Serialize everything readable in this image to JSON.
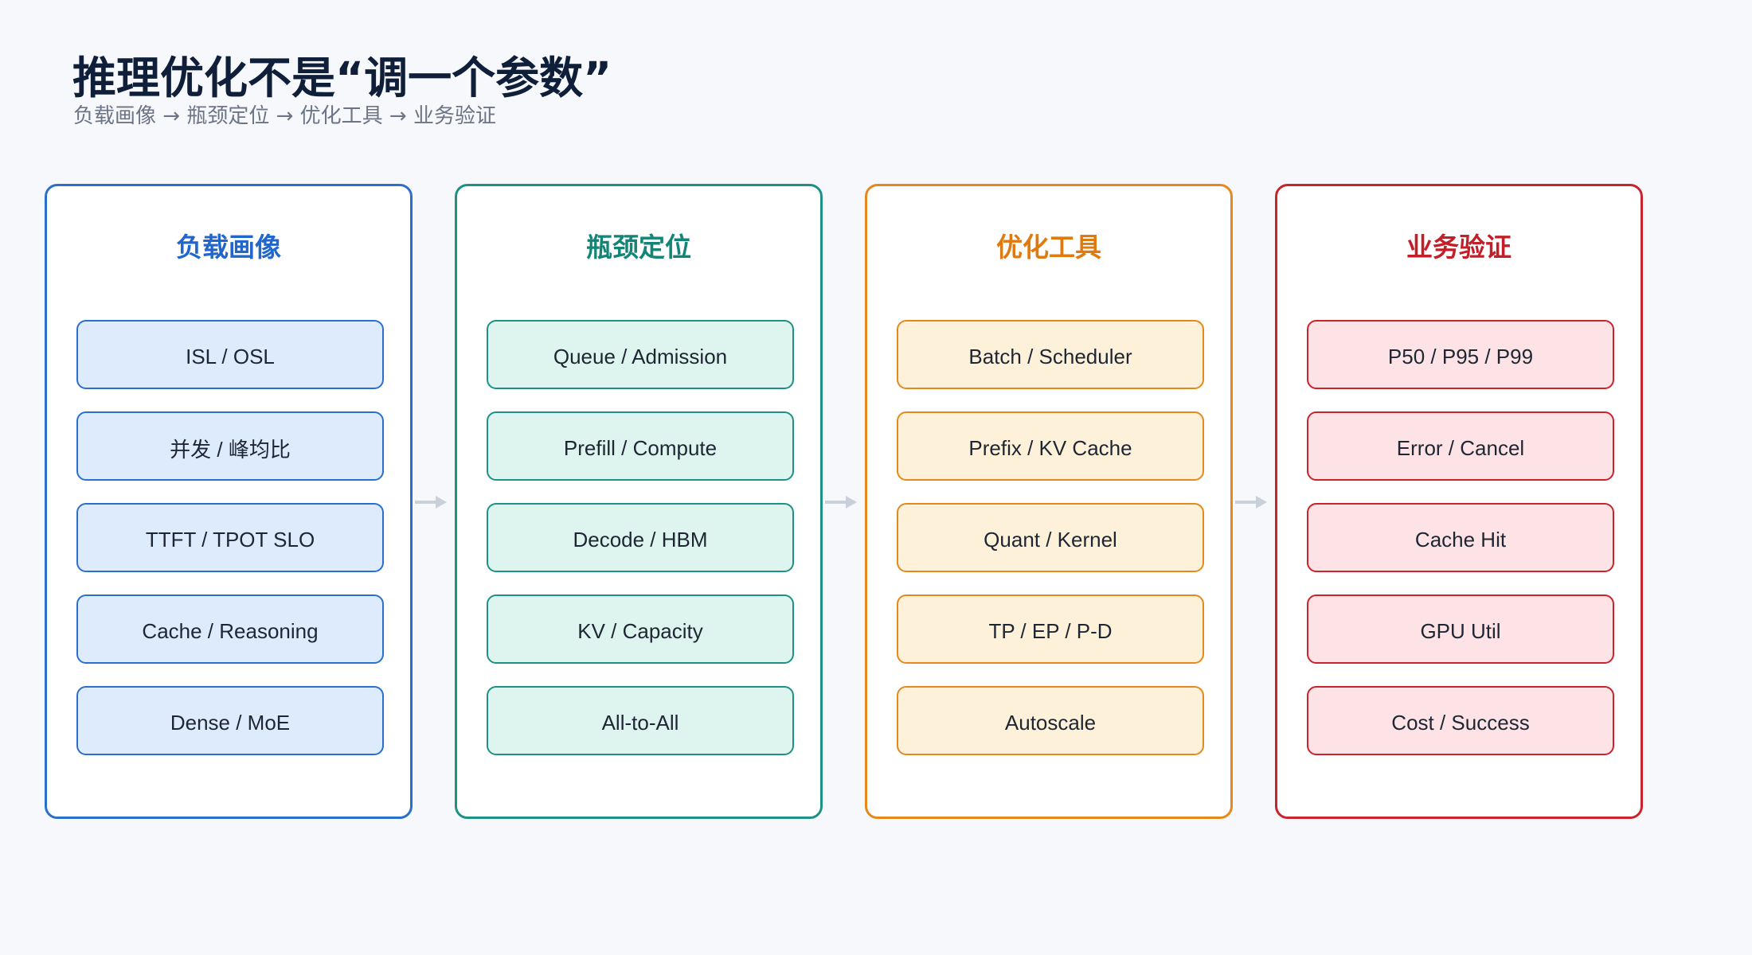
{
  "title": "推理优化不是“调一个参数”",
  "subtitle": "负载画像 → 瓶颈定位 → 优化工具 → 业务验证",
  "columns": [
    {
      "title": "负载画像",
      "items": [
        "ISL / OSL",
        "并发 / 峰均比",
        "TTFT / TPOT SLO",
        "Cache / Reasoning",
        "Dense / MoE"
      ]
    },
    {
      "title": "瓶颈定位",
      "items": [
        "Queue / Admission",
        "Prefill / Compute",
        "Decode / HBM",
        "KV / Capacity",
        "All-to-All"
      ]
    },
    {
      "title": "优化工具",
      "items": [
        "Batch / Scheduler",
        "Prefix / KV Cache",
        "Quant / Kernel",
        "TP / EP / P-D",
        "Autoscale"
      ]
    },
    {
      "title": "业务验证",
      "items": [
        "P50 / P95 / P99",
        "Error / Cancel",
        "Cache Hit",
        "GPU Util",
        "Cost / Success"
      ]
    }
  ],
  "colors": {
    "workload": "#2b6fcc",
    "bottleneck": "#1d9186",
    "tools": "#e5891e",
    "validation": "#c9232b",
    "arrow": "#c9d0da"
  }
}
